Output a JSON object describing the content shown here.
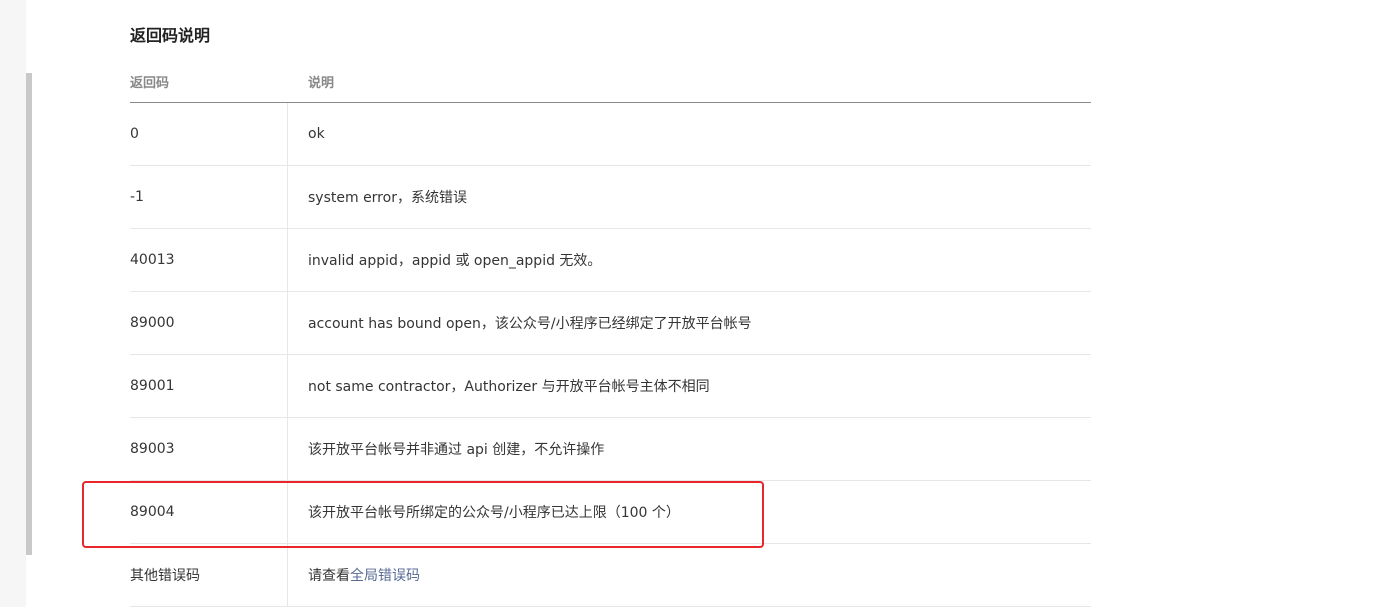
{
  "section": {
    "title": "返回码说明"
  },
  "table": {
    "headers": [
      "返回码",
      "说明"
    ],
    "rows": [
      {
        "code": "0",
        "desc": "ok"
      },
      {
        "code": "-1",
        "desc": "system error，系统错误"
      },
      {
        "code": "40013",
        "desc": "invalid appid，appid 或 open_appid 无效。"
      },
      {
        "code": "89000",
        "desc": "account has bound open，该公众号/小程序已经绑定了开放平台帐号"
      },
      {
        "code": "89001",
        "desc": "not same contractor，Authorizer 与开放平台帐号主体不相同"
      },
      {
        "code": "89003",
        "desc": "该开放平台帐号并非通过 api 创建，不允许操作"
      },
      {
        "code": "89004",
        "desc": "该开放平台帐号所绑定的公众号/小程序已达上限（100 个）"
      }
    ],
    "last_row": {
      "code": "其他错误码",
      "desc_prefix": "请查看",
      "link_text": "全局错误码"
    }
  },
  "colors": {
    "highlight": "#e8262b",
    "link": "#576b95",
    "header_rule": "#8a8a8a"
  }
}
